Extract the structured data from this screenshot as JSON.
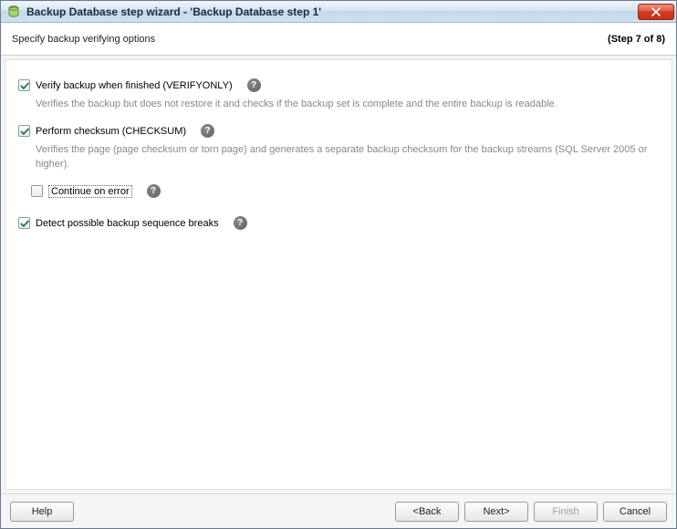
{
  "window": {
    "title": "Backup Database step wizard - 'Backup Database step 1'"
  },
  "header": {
    "subtitle": "Specify backup verifying options",
    "step_label": "(Step 7 of 8)"
  },
  "options": {
    "verify": {
      "label": "Verify backup when finished (VERIFYONLY)",
      "checked": true,
      "desc": "Verifies the backup but does not restore it and checks if the backup set is complete and the entire backup is readable."
    },
    "checksum": {
      "label": "Perform checksum (CHECKSUM)",
      "checked": true,
      "desc": "Verifies the page (page checksum or torn page) and generates a separate backup checksum for the backup streams (SQL Server 2005 or higher)."
    },
    "continue_on_error": {
      "label": "Continue on error",
      "checked": false
    },
    "detect_breaks": {
      "label": "Detect possible backup sequence breaks",
      "checked": true
    }
  },
  "buttons": {
    "help": "Help",
    "back": "<Back",
    "next": "Next>",
    "finish": "Finish",
    "cancel": "Cancel"
  },
  "help_glyph": "?"
}
